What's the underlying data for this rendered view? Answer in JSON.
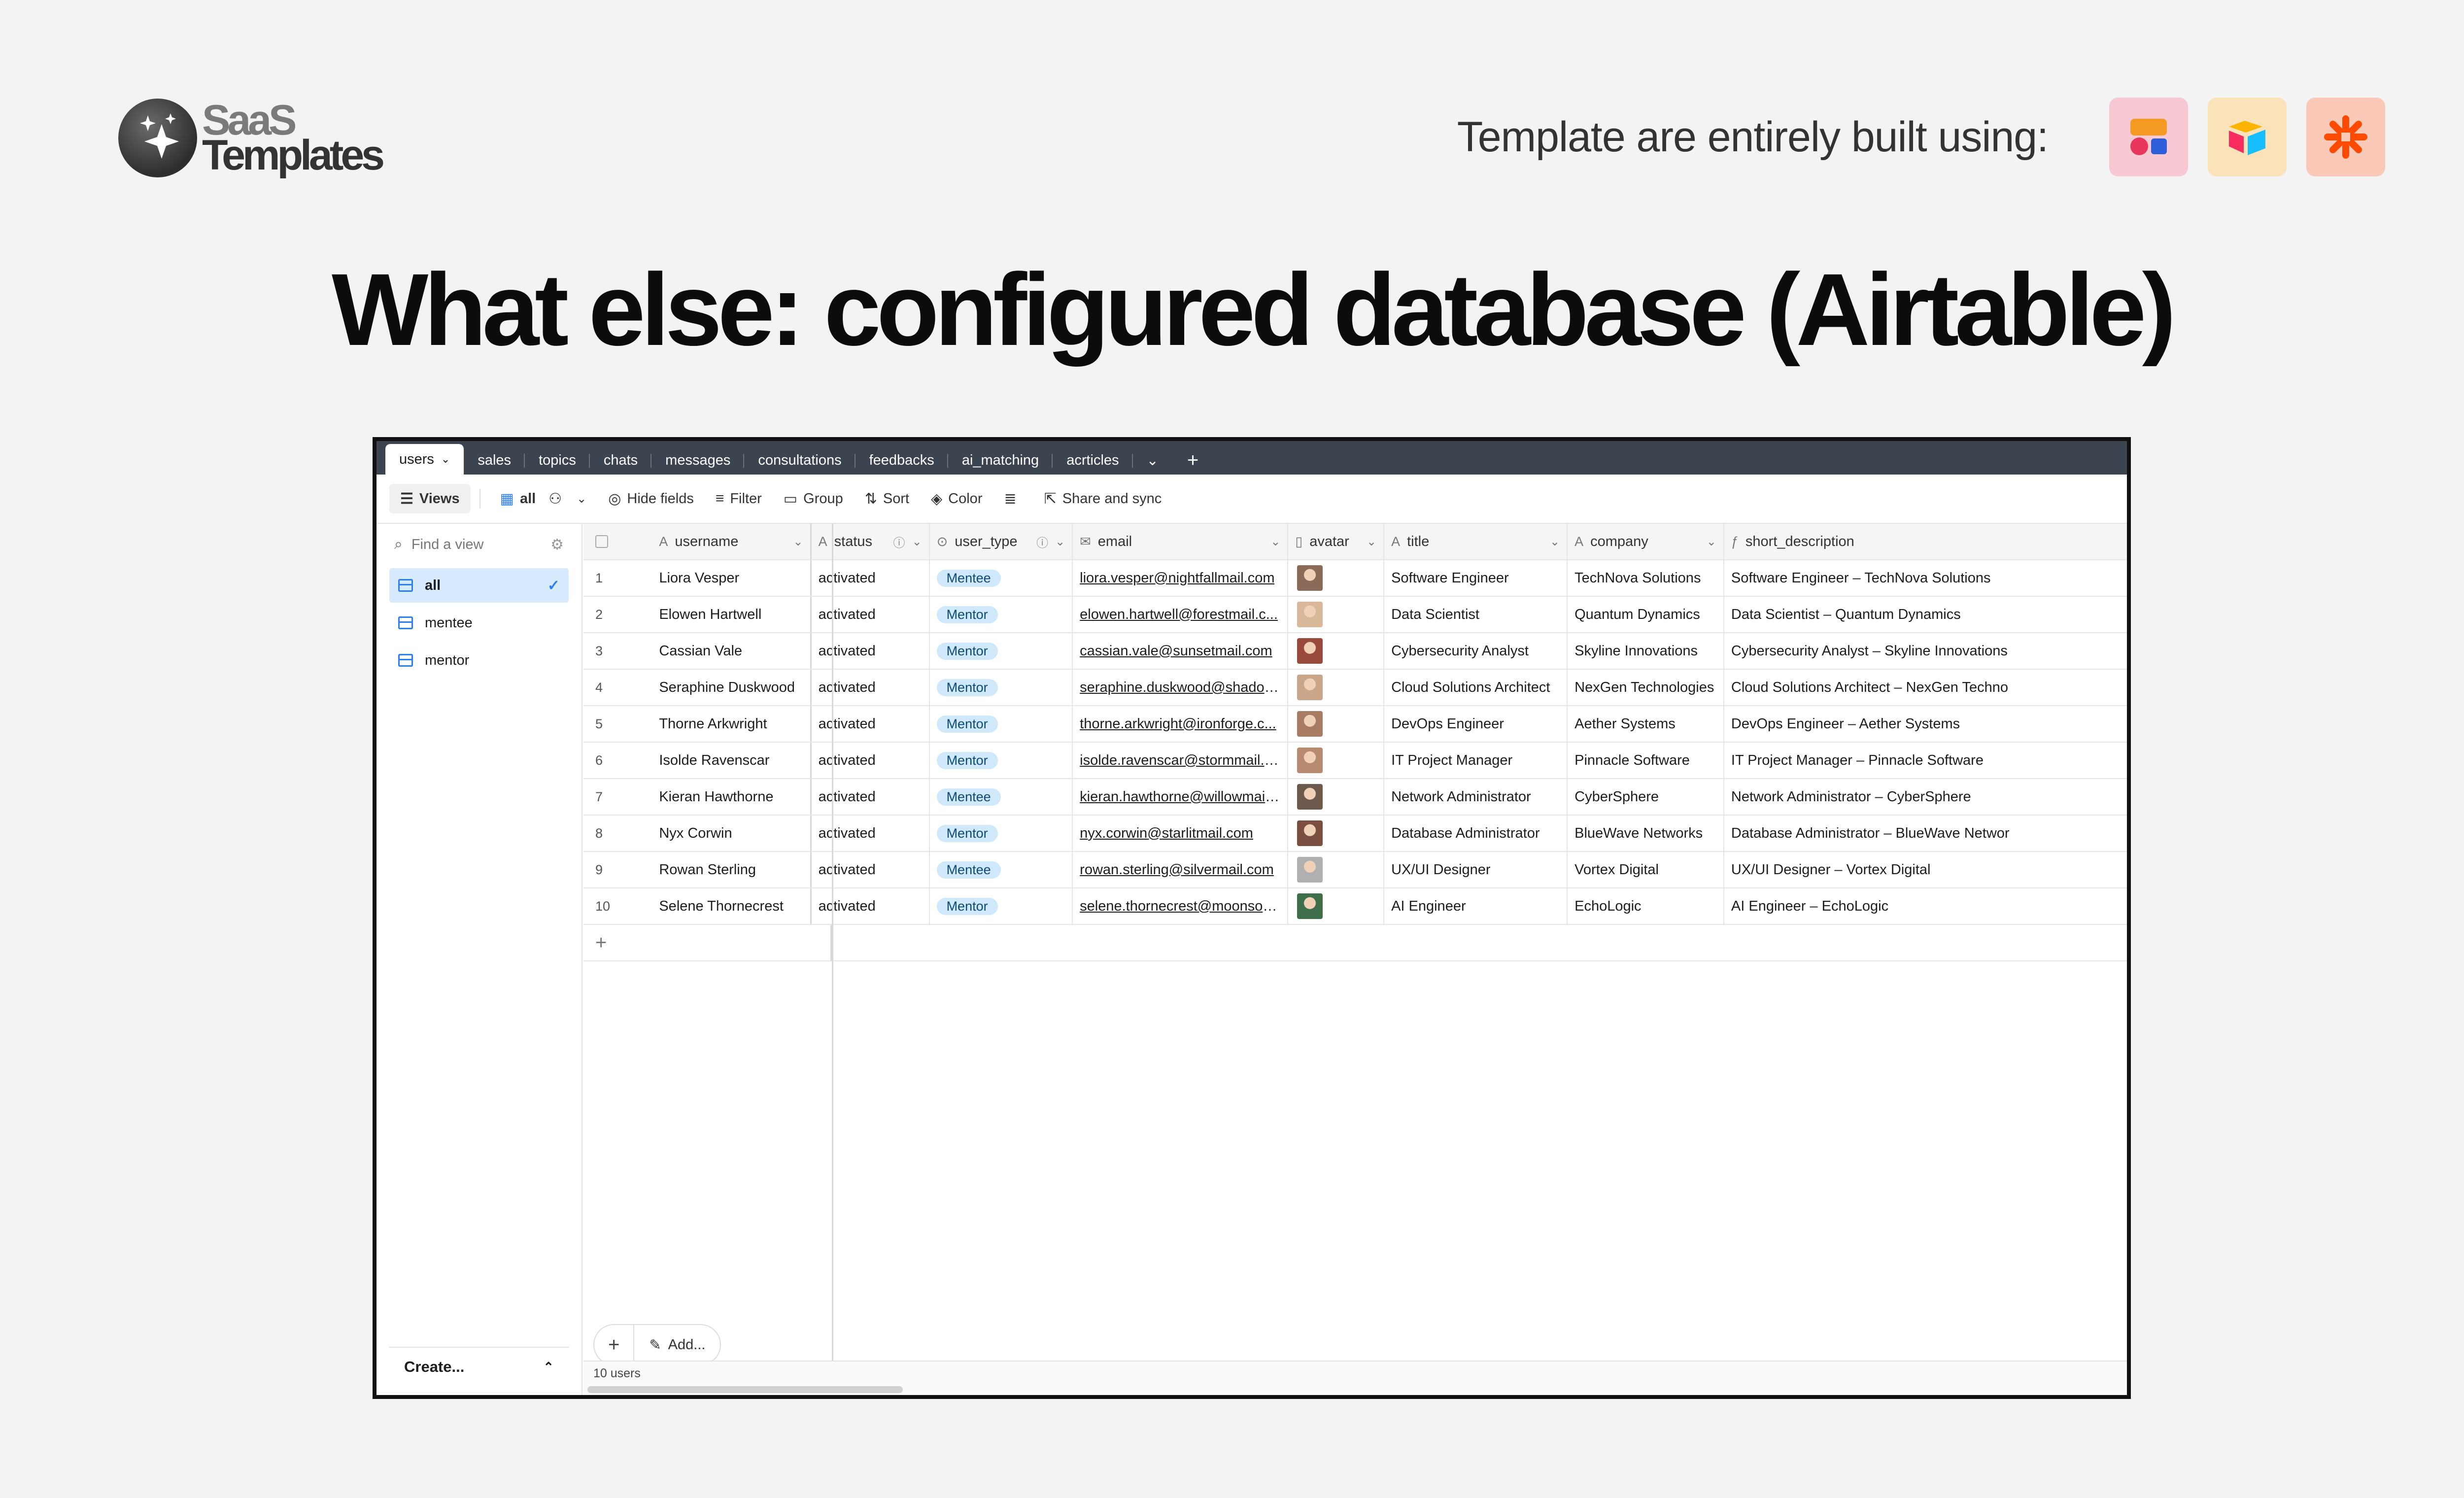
{
  "brand": {
    "line1": "SaaS",
    "line2": "Templates"
  },
  "built_with": {
    "label": "Template are entirely built using:",
    "tools": [
      "softr-icon",
      "airtable-icon",
      "zapier-icon"
    ]
  },
  "headline": "What else: configured database (Airtable)",
  "tabs": [
    {
      "label": "users",
      "active": true
    },
    {
      "label": "sales"
    },
    {
      "label": "topics"
    },
    {
      "label": "chats"
    },
    {
      "label": "messages"
    },
    {
      "label": "consultations"
    },
    {
      "label": "feedbacks"
    },
    {
      "label": "ai_matching"
    },
    {
      "label": "acrticles"
    }
  ],
  "tab_more": "⌄",
  "tab_add": "+",
  "toolbar": {
    "views": "Views",
    "current_view": "all",
    "hide_fields": "Hide fields",
    "filter": "Filter",
    "group": "Group",
    "sort": "Sort",
    "color": "Color",
    "share": "Share and sync"
  },
  "sidebar": {
    "find_placeholder": "Find a view",
    "views": [
      "all",
      "mentee",
      "mentor"
    ],
    "create": "Create..."
  },
  "columns": [
    "username",
    "status",
    "user_type",
    "email",
    "avatar",
    "title",
    "company",
    "short_description"
  ],
  "rows": [
    {
      "n": "1",
      "username": "Liora Vesper",
      "status": "activated",
      "type": "Mentee",
      "email": "liora.vesper@nightfallmail.com",
      "title": "Software Engineer",
      "company": "TechNova Solutions",
      "desc": "Software Engineer – TechNova Solutions"
    },
    {
      "n": "2",
      "username": "Elowen Hartwell",
      "status": "activated",
      "type": "Mentor",
      "email": "elowen.hartwell@forestmail.c...",
      "title": "Data Scientist",
      "company": "Quantum Dynamics",
      "desc": "Data Scientist – Quantum Dynamics"
    },
    {
      "n": "3",
      "username": "Cassian Vale",
      "status": "activated",
      "type": "Mentor",
      "email": "cassian.vale@sunsetmail.com",
      "title": "Cybersecurity Analyst",
      "company": "Skyline Innovations",
      "desc": "Cybersecurity Analyst – Skyline Innovations"
    },
    {
      "n": "4",
      "username": "Seraphine Duskwood",
      "status": "activated",
      "type": "Mentor",
      "email": "seraphine.duskwood@shadow...",
      "title": "Cloud Solutions Architect",
      "company": "NexGen Technologies",
      "desc": "Cloud Solutions Architect – NexGen Techno"
    },
    {
      "n": "5",
      "username": "Thorne Arkwright",
      "status": "activated",
      "type": "Mentor",
      "email": "thorne.arkwright@ironforge.c...",
      "title": "DevOps Engineer",
      "company": "Aether Systems",
      "desc": "DevOps Engineer – Aether Systems"
    },
    {
      "n": "6",
      "username": "Isolde Ravenscar",
      "status": "activated",
      "type": "Mentor",
      "email": "isolde.ravenscar@stormmail.c...",
      "title": "IT Project Manager",
      "company": "Pinnacle Software",
      "desc": "IT Project Manager – Pinnacle Software"
    },
    {
      "n": "7",
      "username": "Kieran Hawthorne",
      "status": "activated",
      "type": "Mentee",
      "email": "kieran.hawthorne@willowmail....",
      "title": "Network Administrator",
      "company": "CyberSphere",
      "desc": "Network Administrator – CyberSphere"
    },
    {
      "n": "8",
      "username": "Nyx Corwin",
      "status": "activated",
      "type": "Mentor",
      "email": "nyx.corwin@starlitmail.com",
      "title": "Database Administrator",
      "company": "BlueWave Networks",
      "desc": "Database Administrator – BlueWave Networ"
    },
    {
      "n": "9",
      "username": "Rowan Sterling",
      "status": "activated",
      "type": "Mentee",
      "email": "rowan.sterling@silvermail.com",
      "title": "UX/UI Designer",
      "company": "Vortex Digital",
      "desc": "UX/UI Designer – Vortex Digital"
    },
    {
      "n": "10",
      "username": "Selene Thornecrest",
      "status": "activated",
      "type": "Mentor",
      "email": "selene.thornecrest@moonson...",
      "title": "AI Engineer",
      "company": "EchoLogic",
      "desc": "AI Engineer – EchoLogic"
    }
  ],
  "avatar_colors": [
    "#8a6a58",
    "#d9b89a",
    "#9a4a3a",
    "#c9a58a",
    "#a87c62",
    "#b88a70",
    "#6e5a4c",
    "#7a4e40",
    "#b0b0b0",
    "#3f6e4a"
  ],
  "add_bar": {
    "add": "Add..."
  },
  "footer": "10 users",
  "colors": {
    "tabbar": "#3c4450",
    "accent": "#2d7ff9",
    "pill": "#cfe9fa"
  }
}
